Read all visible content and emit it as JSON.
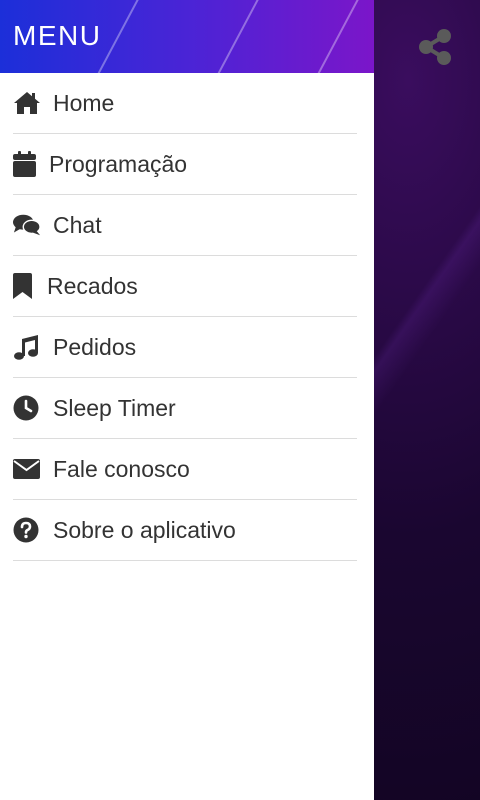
{
  "drawer": {
    "title": "MENU",
    "items": [
      {
        "label": "Home",
        "icon": "home-icon"
      },
      {
        "label": "Programação",
        "icon": "calendar-icon"
      },
      {
        "label": "Chat",
        "icon": "chat-icon"
      },
      {
        "label": "Recados",
        "icon": "bookmark-icon"
      },
      {
        "label": "Pedidos",
        "icon": "music-note-icon"
      },
      {
        "label": "Sleep Timer",
        "icon": "clock-icon"
      },
      {
        "label": "Fale conosco",
        "icon": "envelope-icon"
      },
      {
        "label": "Sobre o aplicativo",
        "icon": "question-circle-icon"
      }
    ]
  },
  "app": {
    "share_icon": "share-icon"
  },
  "colors": {
    "header_start": "#1c2fd9",
    "header_end": "#7b16c9",
    "icon": "#333333",
    "text": "#333333",
    "divider": "#dcdcdc",
    "share_icon": "#5a5a5a"
  }
}
